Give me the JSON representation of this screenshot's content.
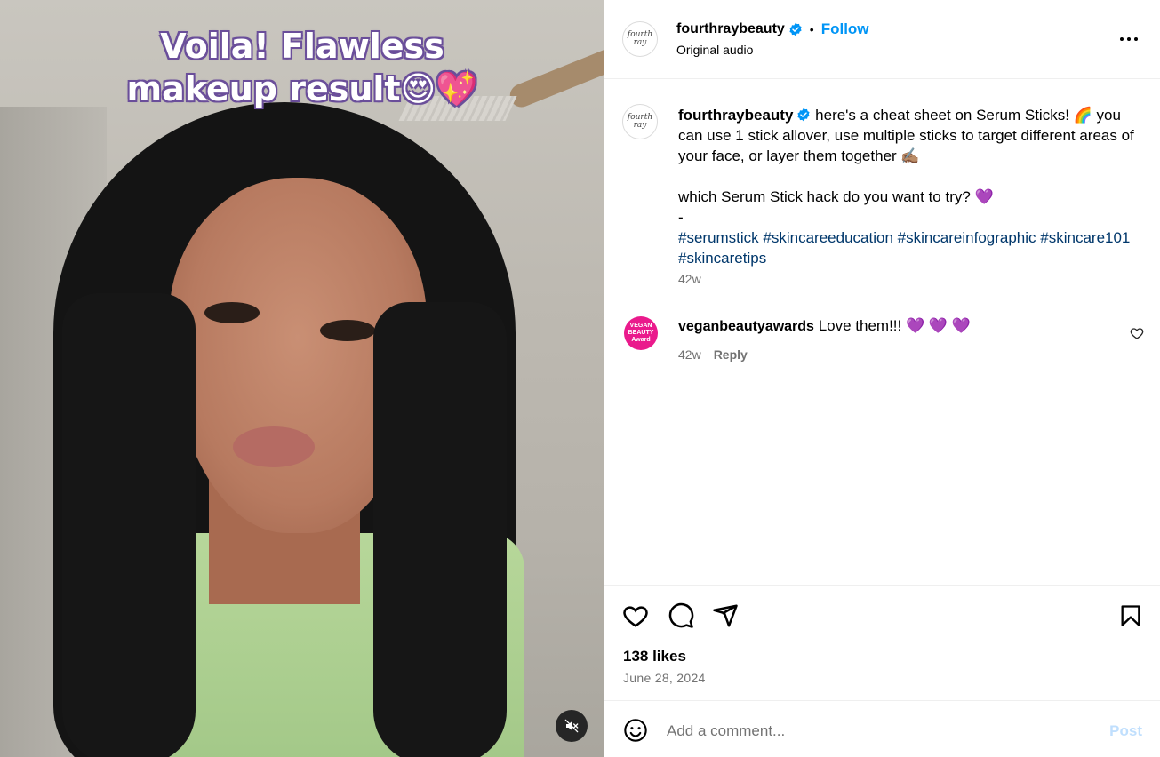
{
  "media": {
    "overlay_line1": "Voila! Flawless",
    "overlay_line2": "makeup result😍💖",
    "mute_icon": "speaker-muted-icon"
  },
  "header": {
    "brand_mark": "fourth ray",
    "username": "fourthraybeauty",
    "separator": "•",
    "follow_label": "Follow",
    "audio_label": "Original audio",
    "more_icon": "more-horizontal-icon"
  },
  "caption": {
    "username": "fourthraybeauty",
    "line1": "here's a cheat sheet on Serum Sticks! 🌈 you can use 1 stick allover, use multiple sticks to target different areas of your face, or layer them together ✍🏽",
    "line2": "which Serum Stick hack do you want to try? 💜",
    "line3": "-",
    "hashtags": "#serumstick #skincareeducation #skincareinfographic #skincare101 #skincaretips",
    "time": "42w"
  },
  "comment": {
    "avatar_text": "VEGAN BEAUTY Award",
    "username": "veganbeautyawards",
    "text": "Love them!!! 💜 💜 💜",
    "time": "42w",
    "reply_label": "Reply"
  },
  "actions": {
    "likes": "138 likes",
    "date": "June 28, 2024"
  },
  "comment_input": {
    "placeholder": "Add a comment...",
    "value": "",
    "post_label": "Post"
  },
  "colors": {
    "accent": "#0095f6",
    "verified": "#0095f6",
    "hashtag": "#00376b",
    "muted_text": "#737373",
    "post_disabled": "#c0dffd"
  }
}
